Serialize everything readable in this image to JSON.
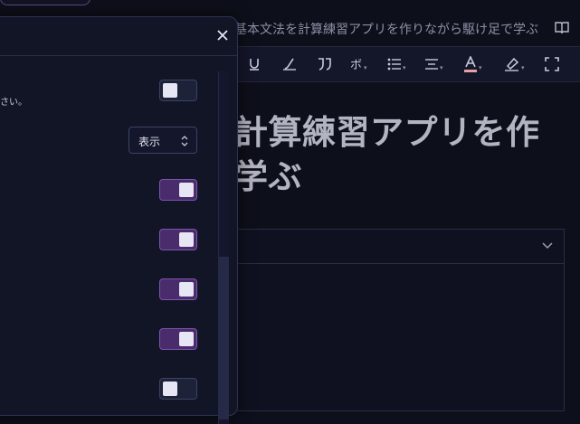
{
  "colors": {
    "accent": "#7a55ad",
    "toggle_on": "#4a2b6b",
    "toggle_off": "#1e2238",
    "panel_bg": "#121526",
    "page_bg": "#0d0f1a"
  },
  "editor": {
    "doc_title": "基本文法を計算練習アプリを作りながら駆け足で学ぶ",
    "heading_line1": "計算練習アプリを作",
    "heading_line2": "学ぶ",
    "toolbar": [
      {
        "icon": "underline-icon"
      },
      {
        "icon": "strikethrough-icon"
      },
      {
        "icon": "quote-icon"
      },
      {
        "icon": "ruby-icon"
      },
      {
        "icon": "bullet-list-icon"
      },
      {
        "icon": "align-icon"
      },
      {
        "icon": "text-color-icon"
      },
      {
        "icon": "highlight-icon"
      },
      {
        "icon": "fullscreen-icon"
      }
    ]
  },
  "settings_panel": {
    "close_icon": "close-icon",
    "description": "さい。",
    "select_value": "表示",
    "toggles": [
      {
        "state": "off"
      },
      {
        "state": "on"
      },
      {
        "state": "on"
      },
      {
        "state": "on"
      },
      {
        "state": "on"
      },
      {
        "state": "off"
      }
    ]
  }
}
